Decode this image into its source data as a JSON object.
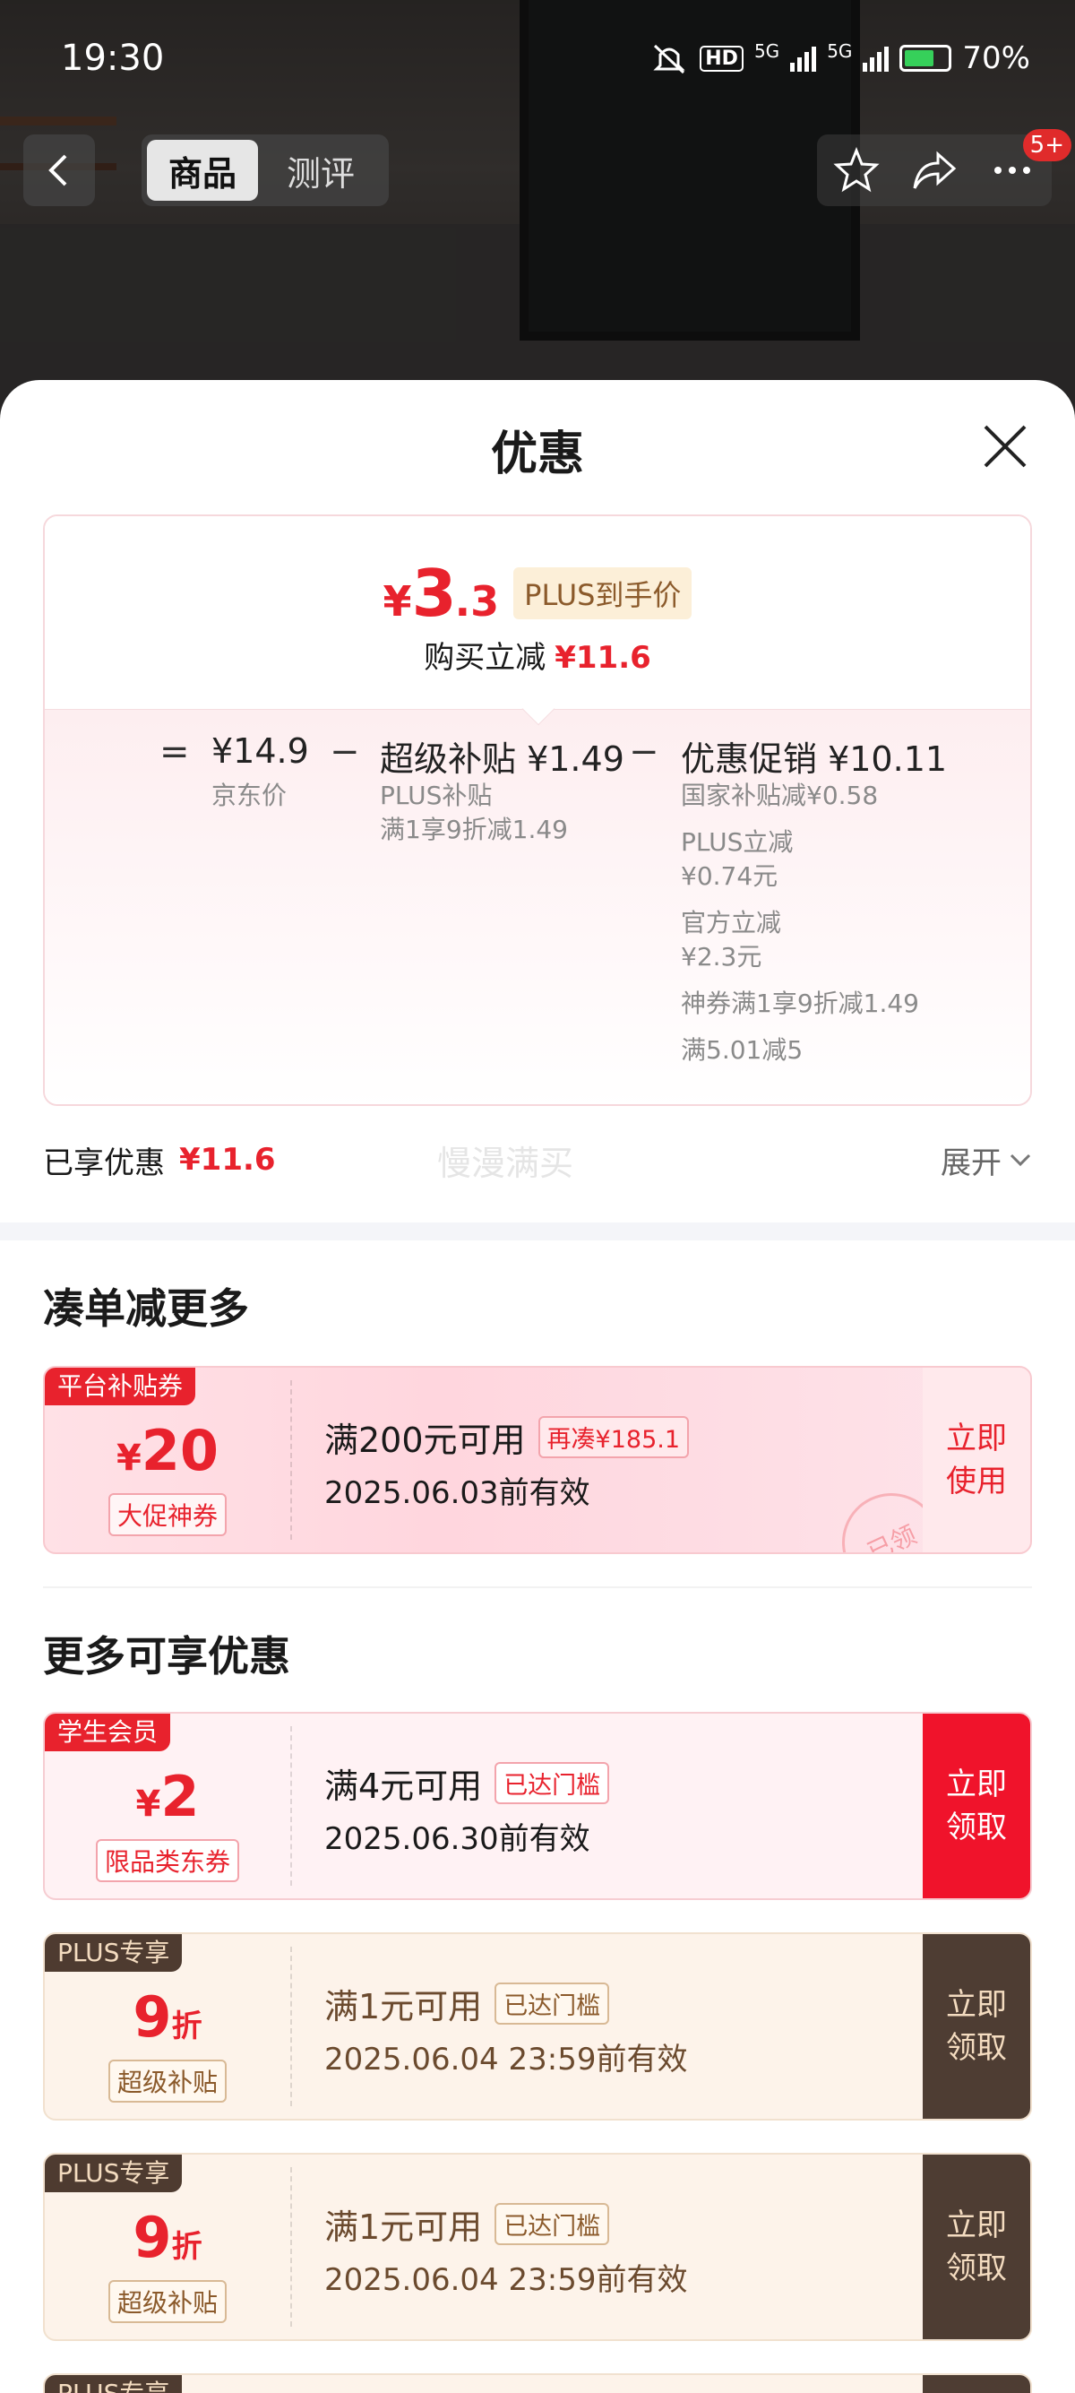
{
  "status_bar": {
    "time": "19:30",
    "hd": "HD",
    "net1": "5G",
    "net2": "5G",
    "battery": "70%"
  },
  "nav": {
    "tabs": [
      "商品",
      "测评"
    ],
    "badge": "5+"
  },
  "sheet": {
    "title": "优惠",
    "final_price": {
      "yen": "¥",
      "integer": "3",
      "decimal": ".3",
      "tag": "PLUS到手价"
    },
    "reduce_label": "购买立减",
    "reduce_value": "¥11.6",
    "formula": {
      "eq": "=",
      "minus": "−",
      "jd_price": "¥14.9",
      "jd_label": "京东价",
      "super_title": "超级补贴 ¥1.49",
      "super_lines": [
        "PLUS补贴",
        "满1享9折减1.49"
      ],
      "promo_title": "优惠促销 ¥10.11",
      "promo_lines": [
        "国家补贴减¥0.58",
        "PLUS立减",
        "¥0.74元",
        "官方立减",
        "¥2.3元",
        "神券满1享9折减1.49",
        "满5.01减5"
      ]
    },
    "summary": {
      "label": "已享优惠",
      "value": "¥11.6",
      "ghost": "慢漫满买",
      "expand": "展开"
    },
    "section1": "凑单减更多",
    "section2": "更多可享优惠"
  },
  "coupons": [
    {
      "tag": "平台补贴券",
      "yen": "¥",
      "amount": "20",
      "sub": "大促神券",
      "cond": "满200元可用",
      "chip": "再凑¥185.1",
      "valid": "2025.06.03前有效",
      "action1": "立即",
      "action2": "使用",
      "stamp": "已领"
    },
    {
      "tag": "学生会员",
      "yen": "¥",
      "amount": "2",
      "sub": "限品类东券",
      "cond": "满4元可用",
      "chip": "已达门槛",
      "valid": "2025.06.30前有效",
      "action1": "立即",
      "action2": "领取"
    },
    {
      "tag": "PLUS专享",
      "amount": "9",
      "unit": "折",
      "sub": "超级补贴",
      "cond": "满1元可用",
      "chip": "已达门槛",
      "valid": "2025.06.04 23:59前有效",
      "action1": "立即",
      "action2": "领取"
    },
    {
      "tag": "PLUS专享",
      "amount": "9",
      "unit": "折",
      "sub": "超级补贴",
      "cond": "满1元可用",
      "chip": "已达门槛",
      "valid": "2025.06.04 23:59前有效",
      "action1": "立即",
      "action2": "领取"
    },
    {
      "tag": "PLUS专享"
    }
  ],
  "colors": {
    "accent_red": "#e8222d",
    "plus_brown": "#4e3d33"
  }
}
